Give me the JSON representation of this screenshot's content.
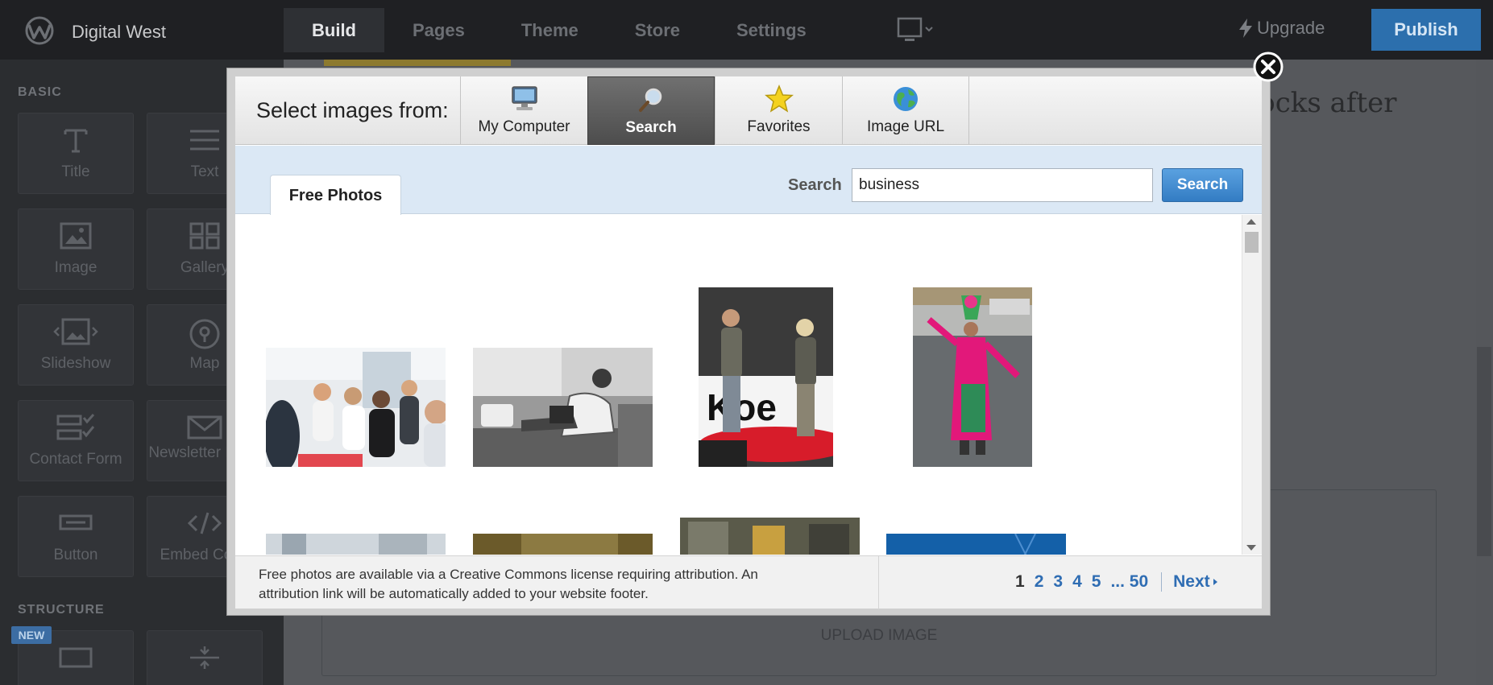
{
  "topbar": {
    "site_name": "Digital West",
    "nav": [
      "Build",
      "Pages",
      "Theme",
      "Store",
      "Settings"
    ],
    "active_nav": "Build",
    "upgrade": "Upgrade",
    "publish": "Publish"
  },
  "sidebar": {
    "basic_label": "BASIC",
    "structure_label": "STRUCTURE",
    "new_badge": "NEW",
    "tiles": [
      "Title",
      "Text",
      "Image",
      "Gallery",
      "Slideshow",
      "Map",
      "Contact Form",
      "Newsletter Form",
      "Button",
      "Embed Code"
    ]
  },
  "editor": {
    "body_text": "it locks after",
    "upload_label": "UPLOAD IMAGE"
  },
  "modal": {
    "select_label": "Select images from:",
    "sources": [
      {
        "label": "My Computer",
        "icon": "computer-icon"
      },
      {
        "label": "Search",
        "icon": "magnifier-icon",
        "active": true
      },
      {
        "label": "Favorites",
        "icon": "star-icon"
      },
      {
        "label": "Image URL",
        "icon": "globe-icon"
      }
    ],
    "tab": "Free Photos",
    "search_label": "Search",
    "search_value": "business",
    "search_button": "Search",
    "footer_note": "Free photos are available via a Creative Commons license requiring attribution. An attribution link will be automatically added to your website footer.",
    "pages": [
      "1",
      "2",
      "3",
      "4",
      "5",
      "... 50"
    ],
    "current_page": "1",
    "next": "Next"
  },
  "colors": {
    "accent_blue": "#2f6db3",
    "publish_blue": "#2c6fad",
    "topbar_bg": "#1f2023",
    "sidebar_bg": "#2b2d30"
  }
}
